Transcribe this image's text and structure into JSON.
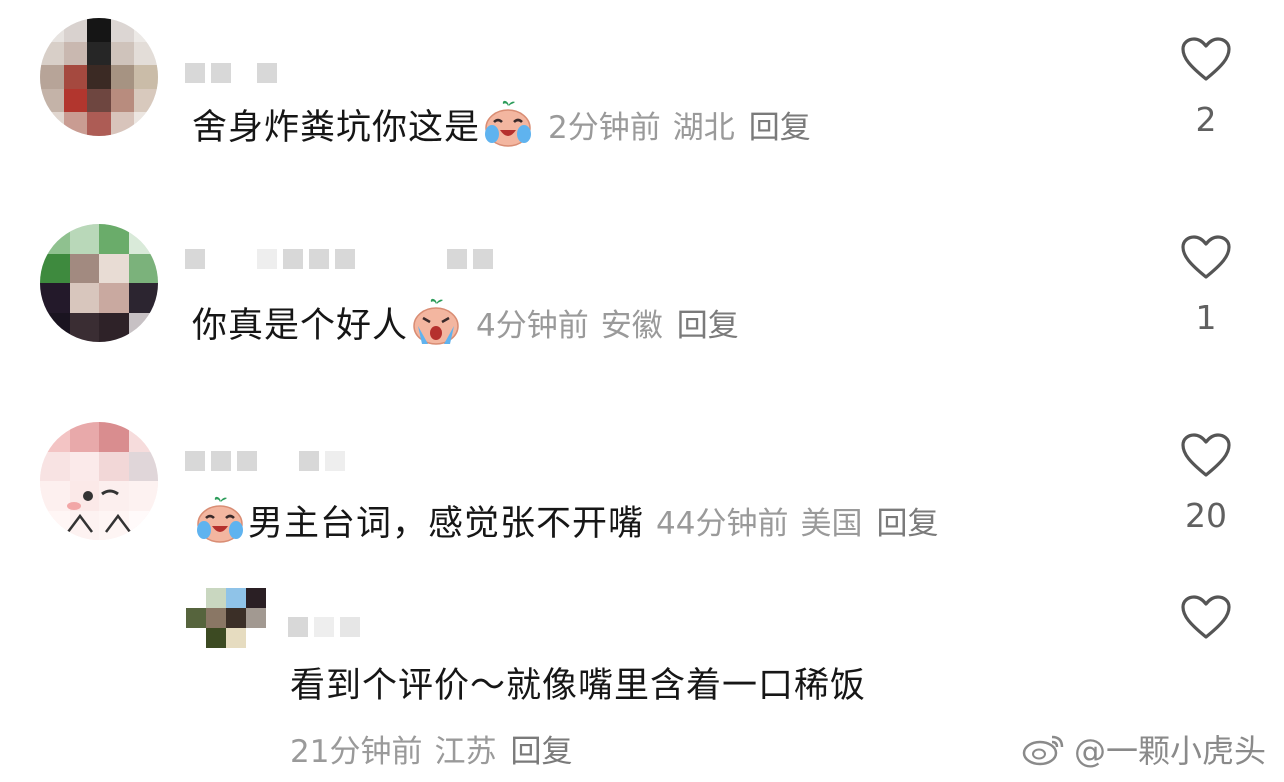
{
  "comments": [
    {
      "text": "舍身炸粪坑你这是",
      "emoji": "crying-laughing-face-emoji",
      "time": "2分钟前",
      "location": "湖北",
      "reply_label": "回复",
      "likes": "2"
    },
    {
      "text": "你真是个好人",
      "emoji": "crying-face-emoji",
      "time": "4分钟前",
      "location": "安徽",
      "reply_label": "回复",
      "likes": "1"
    },
    {
      "text": "男主台词，感觉张不开嘴",
      "emoji": "crying-laughing-face-emoji",
      "time": "44分钟前",
      "location": "美国",
      "reply_label": "回复",
      "likes": "20"
    }
  ],
  "reply": {
    "text": "看到个评价～就像嘴里含着一口稀饭",
    "time": "21分钟前",
    "location": "江苏",
    "reply_label": "回复",
    "likes": ""
  },
  "watermark": {
    "text": "@一颗小虎头",
    "icon": "weibo-logo-icon"
  },
  "colors": {
    "text": "#161616",
    "meta": "#9a9a9a",
    "like_icon": "#555555",
    "emoji_face": "#f3b6a0"
  }
}
